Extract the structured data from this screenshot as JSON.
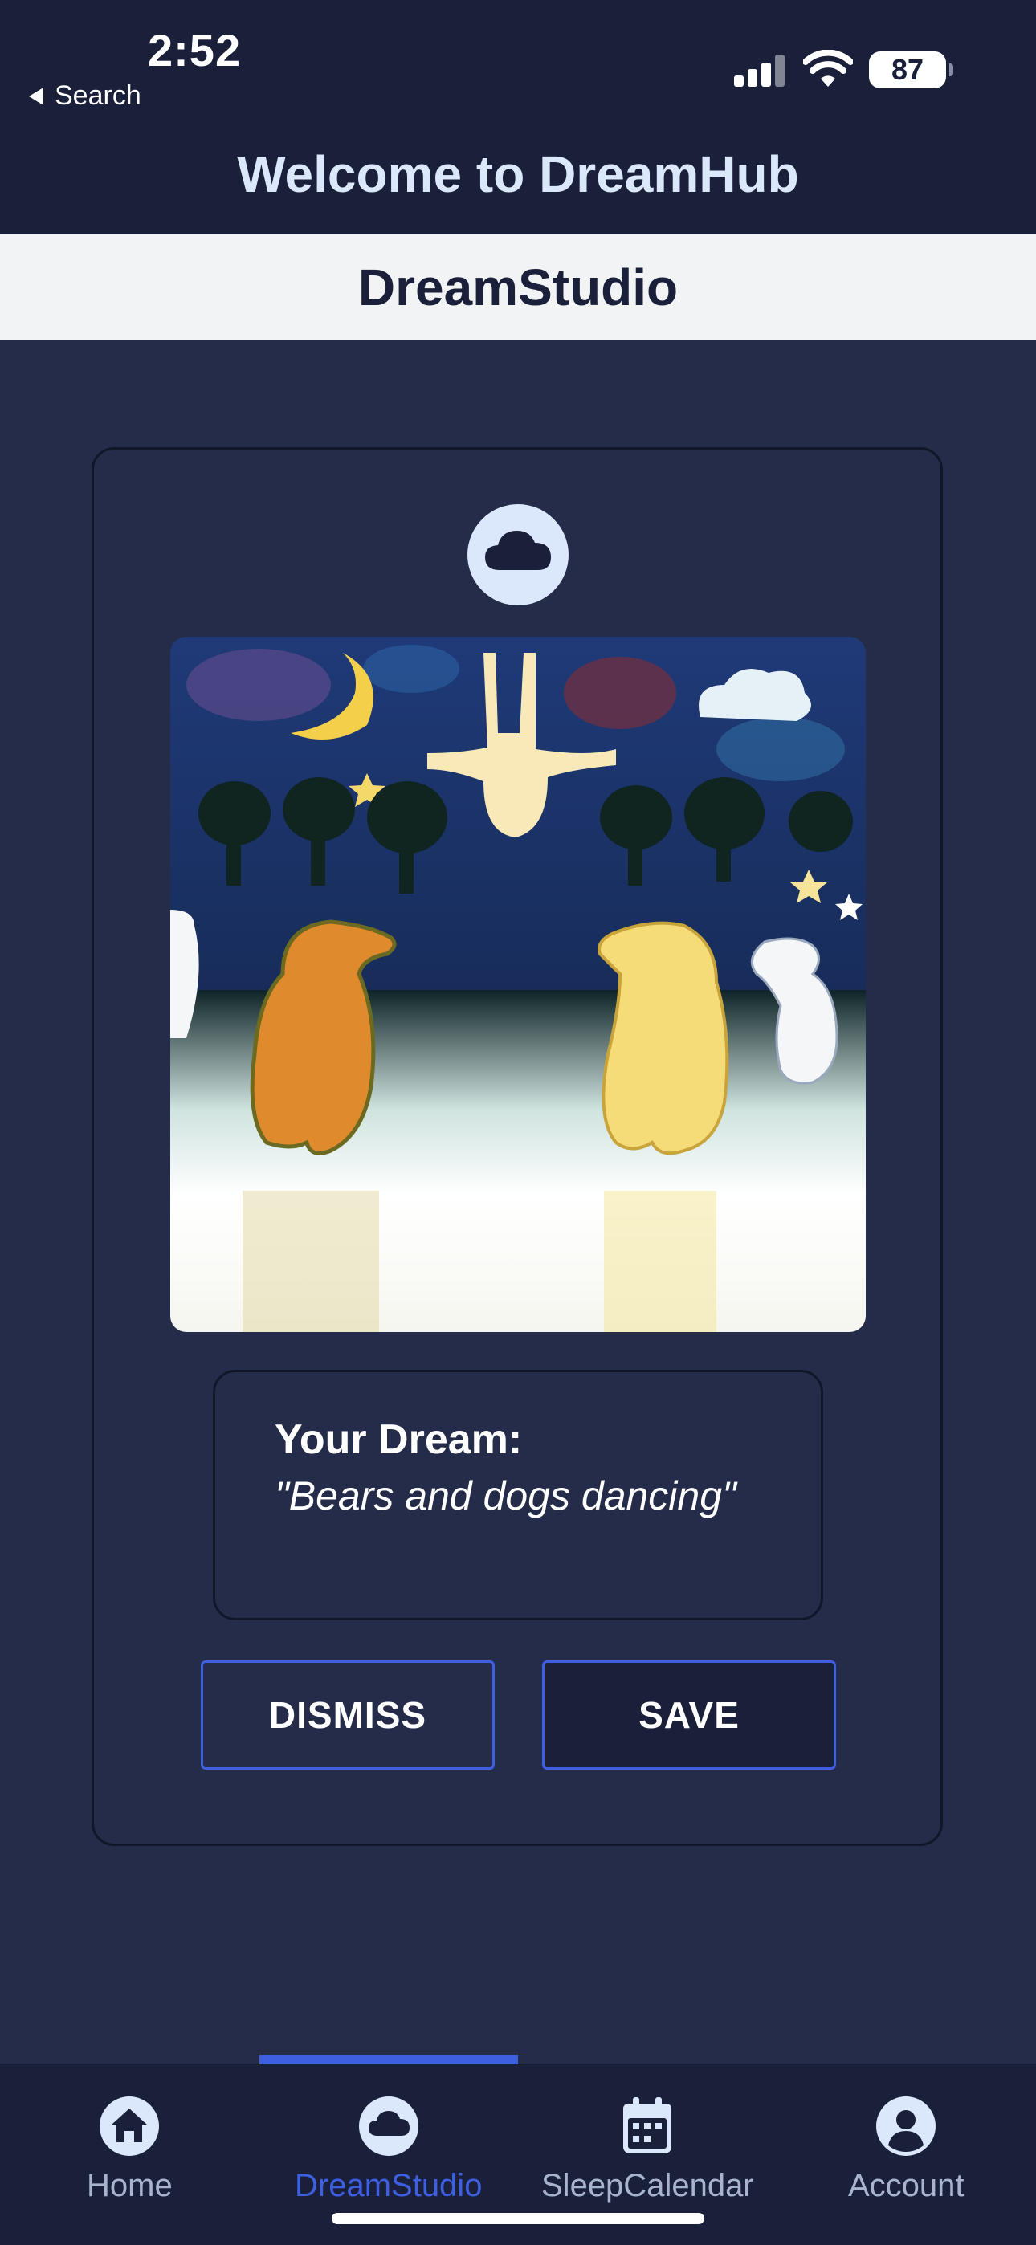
{
  "status_bar": {
    "time": "2:52",
    "back_label": "Search",
    "battery": "87"
  },
  "header": {
    "title": "Welcome to DreamHub"
  },
  "subheader": {
    "title": "DreamStudio"
  },
  "dream_card": {
    "badge_icon": "cloud-icon",
    "image_icon": "dream-illustration",
    "dream_label": "Your Dream:",
    "dream_text": "\"Bears and dogs dancing\"",
    "dismiss_label": "DISMISS",
    "save_label": "SAVE"
  },
  "tabs": [
    {
      "label": "Home",
      "icon": "home-icon",
      "active": false
    },
    {
      "label": "DreamStudio",
      "icon": "cloud-icon",
      "active": true
    },
    {
      "label": "SleepCalendar",
      "icon": "calendar-icon",
      "active": false
    },
    {
      "label": "Account",
      "icon": "account-icon",
      "active": false
    }
  ],
  "colors": {
    "background": "#242c4a",
    "header_bg": "#1a1f3a",
    "accent": "#3d5fe0",
    "title_text": "#dbe8fb",
    "inactive_tab": "#a7b4cc"
  }
}
